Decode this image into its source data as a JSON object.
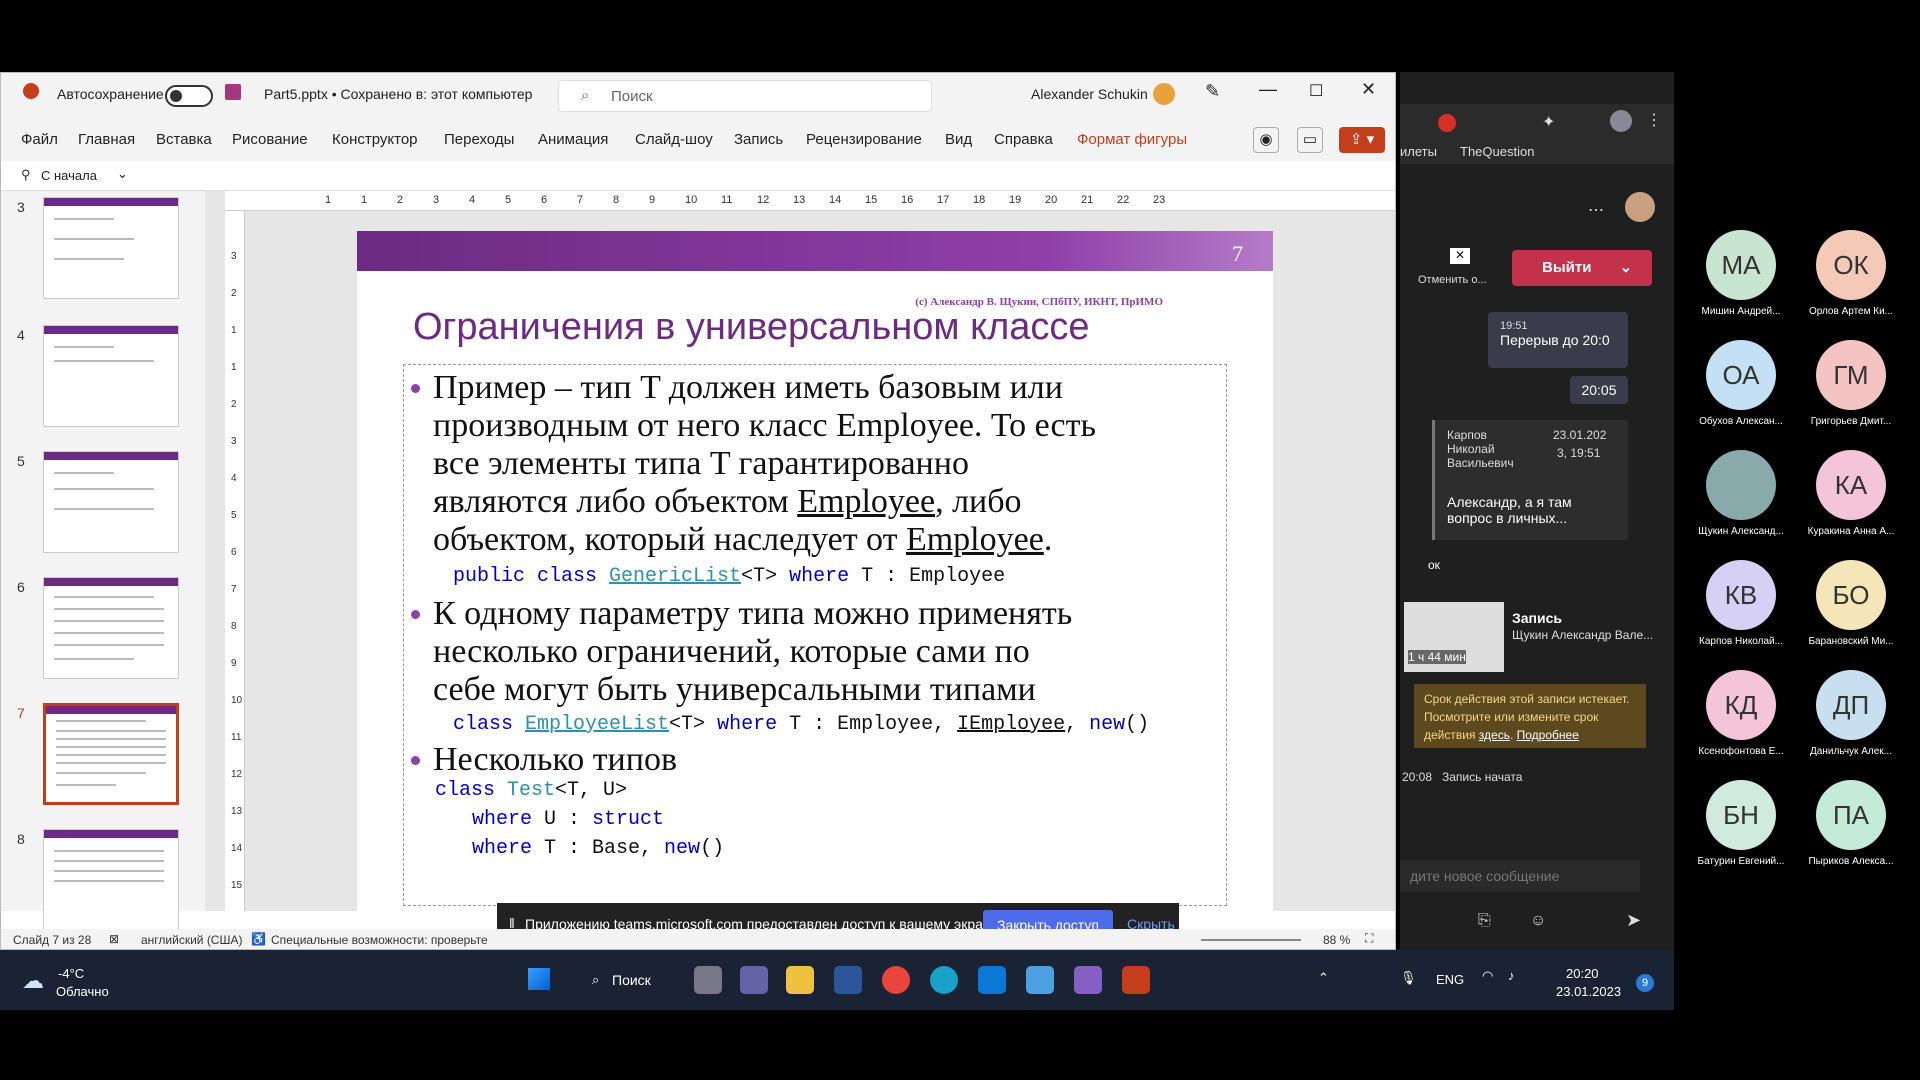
{
  "ppt": {
    "autosave_label": "Автосохранение",
    "filename": "Part5.pptx • Сохранено в: этот компьютер",
    "search_placeholder": "Поиск",
    "user": "Alexander Schukin",
    "menu": [
      "Файл",
      "Главная",
      "Вставка",
      "Рисование",
      "Конструктор",
      "Переходы",
      "Анимация",
      "Слайд-шоу",
      "Запись",
      "Рецензирование",
      "Вид",
      "Справка",
      "Формат фигуры"
    ],
    "from_start": "С начала",
    "ruler_h": [
      "1",
      "1",
      "2",
      "3",
      "4",
      "5",
      "6",
      "7",
      "8",
      "9",
      "10",
      "11",
      "12",
      "13",
      "14",
      "15",
      "16",
      "17",
      "18",
      "19",
      "20",
      "21",
      "22",
      "23"
    ],
    "ruler_v": [
      "3",
      "2",
      "1",
      "1",
      "2",
      "3",
      "4",
      "5",
      "6",
      "7",
      "8",
      "9",
      "10",
      "11",
      "12",
      "13",
      "14",
      "15"
    ],
    "thumb_numbers": [
      "3",
      "4",
      "5",
      "6",
      "7",
      "8"
    ],
    "slide": {
      "number": "7",
      "credit": "(с) Александр В. Щукин, СПбПУ, ИКНТ, ПрИМО",
      "title": "Ограничения в универсальном классе",
      "b1": [
        "Пример – тип T должен иметь базовым или",
        "производным от него класс Employee. То есть",
        "все элементы типа T гарантированно",
        "являются либо объектом ",
        "Employee",
        ", либо",
        "объектом, который наследует от ",
        "Employee",
        "."
      ],
      "code1": [
        "public class ",
        "GenericList",
        "<T> ",
        "where",
        " T : Employee"
      ],
      "b2": [
        "К одному параметру типа можно применять",
        "несколько ограничений, которые сами по",
        "себе могут быть универсальными типами"
      ],
      "code2": [
        "class ",
        "EmployeeList",
        "<T> ",
        "where",
        " T : Employee, ",
        "IEmployee",
        ", ",
        "new",
        "()"
      ],
      "b3": "Несколько типов",
      "code3": [
        "class ",
        "Test",
        "<T, U>"
      ],
      "code4": [
        "where",
        " U : ",
        "struct"
      ],
      "code5": [
        "where",
        " T : Base, ",
        "new",
        "()"
      ]
    },
    "share": {
      "text": "Приложению teams.microsoft.com предоставлен доступ к вашему экрану.",
      "stop": "Закрыть доступ",
      "hide": "Скрыть"
    },
    "status": {
      "slide": "Слайд 7 из 28",
      "lang": "английский (США)",
      "access": "Специальные возможности: проверьте рекомендации",
      "zoom": "88 %"
    }
  },
  "teams": {
    "bookmark1": "илеты",
    "bookmark2": "TheQuestion",
    "cancel": "Отменить о...",
    "leave": "Выйти",
    "msg1_time": "19:51",
    "msg1": "Перерыв до 20:0",
    "msg2": "20:05",
    "quote_name": "Карпов Николай Васильевич",
    "quote_date": "23.01.202",
    "quote_time": "3, 19:51",
    "quote_text": "Александр, а я там вопрос в личных...",
    "ok": "ок",
    "rec_title": "Запись",
    "rec_by": "Щукин Александр Вале...",
    "rec_len": "1 ч 44 мин",
    "rec_notice": "Срок действия этой записи истекает. Посмотрите или измените срок действия ",
    "here": "здесь",
    ".more": "",
    "more": "Подробнее",
    "rec_time": "20:08",
    "rec_started": "Запись начата",
    "compose_placeholder": "дите новое сообщение"
  },
  "gallery": [
    {
      "i": "МА",
      "n": "Мишин Андрей...",
      "c": "#c8e6cf"
    },
    {
      "i": "ОК",
      "n": "Орлов Артем Ки...",
      "c": "#f4c9b8"
    },
    {
      "i": "ОА",
      "n": "Обухов Алексан...",
      "c": "#c4e0f4"
    },
    {
      "i": "ГМ",
      "n": "Григорьев Дмит...",
      "c": "#f4c4c4"
    },
    {
      "i": "",
      "n": "Щукин Александ...",
      "c": "#8aa"
    },
    {
      "i": "КА",
      "n": "Куракина Анна А...",
      "c": "#f4c4d8"
    },
    {
      "i": "КВ",
      "n": "Карпов Николай...",
      "c": "#d6d0f4"
    },
    {
      "i": "БО",
      "n": "Барановский Ми...",
      "c": "#f4e6b8"
    },
    {
      "i": "КД",
      "n": "Ксенофонтова Е...",
      "c": "#f4c4d8"
    },
    {
      "i": "ДП",
      "n": "Данильчук Алек...",
      "c": "#c8dff0"
    },
    {
      "i": "БН",
      "n": "Батурин Евгений...",
      "c": "#d0eadd"
    },
    {
      "i": "ПА",
      "n": "Пыриков Алекса...",
      "c": "#c4ead8"
    }
  ],
  "taskbar": {
    "temp": "-4°C",
    "weather": "Облачно",
    "search": "Поиск",
    "lang": "ENG",
    "time": "20:20",
    "date": "23.01.2023",
    "notif": "9"
  }
}
